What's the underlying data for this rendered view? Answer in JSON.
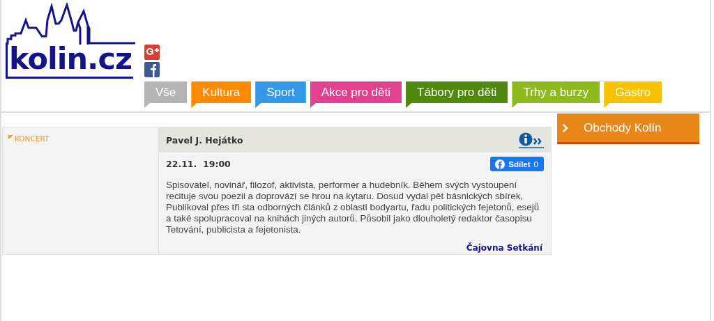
{
  "logo": {
    "text": "kolin.cz"
  },
  "tabs": [
    {
      "label": "Vše",
      "color": "#b4b4b4"
    },
    {
      "label": "Kultura",
      "color": "#ff8a00"
    },
    {
      "label": "Sport",
      "color": "#3399e6"
    },
    {
      "label": "Akce pro děti",
      "color": "#e2418f"
    },
    {
      "label": "Tábory pro děti",
      "color": "#4f8a0e"
    },
    {
      "label": "Trhy a burzy",
      "color": "#8fba1e"
    },
    {
      "label": "Gastro",
      "color": "#f8c200"
    }
  ],
  "event": {
    "category": "KONCERT",
    "title": "Pavel J. Hejátko",
    "date": "22.11.",
    "time": "19:00",
    "share": {
      "label": "Sdílet",
      "count": "0"
    },
    "description": "Spisovatel, novinář, filozof, aktivista, performer a hudebník. Během svých vystoupení recituje svou poezii a doprovází se hrou na kytaru. Dosud vydal pět básnických sbírek, Publikoval přes tři sta odborných článků z oblasti bodyartu, řadu politických fejetonů, esejů a také spolupracoval na knihách jiných autorů. Působil jako dlouholetý redaktor časopisu Tetování, publicista a fejetonista.",
    "venue": "Čajovna Setkání"
  },
  "sidebar": {
    "button": "Obchody Kolín"
  }
}
